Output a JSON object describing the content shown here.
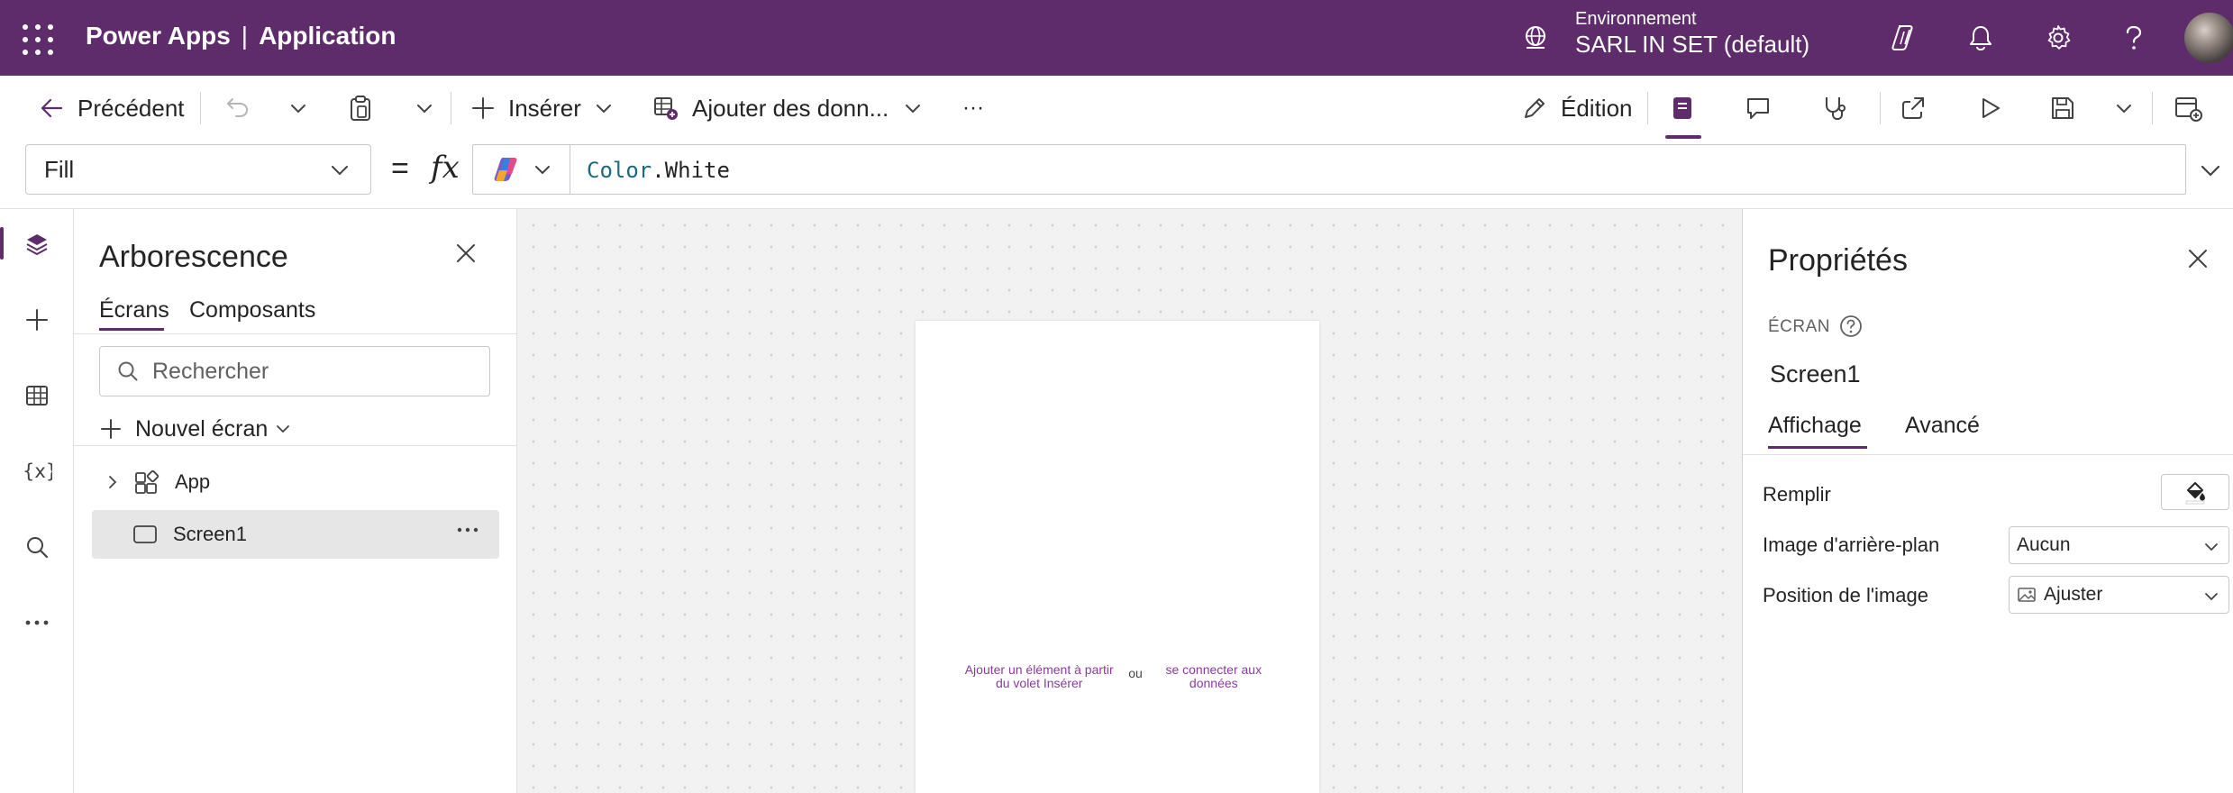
{
  "topbar": {
    "product": "Power Apps",
    "separator": "|",
    "app_name": "Application",
    "environment_label": "Environnement",
    "environment_value": "SARL IN SET (default)"
  },
  "commandbar": {
    "back": "Précédent",
    "insert": "Insérer",
    "add_data": "Ajouter des donn...",
    "more": "···",
    "edit": "Édition"
  },
  "formula": {
    "property": "Fill",
    "equals": "=",
    "fx": "fx",
    "expr_object": "Color",
    "expr_member": ".White"
  },
  "tree": {
    "title": "Arborescence",
    "tabs": [
      "Écrans",
      "Composants"
    ],
    "search_placeholder": "Rechercher",
    "new_screen": "Nouvel écran",
    "items": [
      {
        "label": "App"
      },
      {
        "label": "Screen1"
      }
    ],
    "row_more": "···"
  },
  "canvas": {
    "hint_insert": "Ajouter un élément à partir du volet Insérer",
    "hint_or": "ou",
    "hint_data": "se connecter aux données"
  },
  "properties": {
    "title": "Propriétés",
    "kind": "ÉCRAN",
    "control_name": "Screen1",
    "tabs": [
      "Affichage",
      "Avancé"
    ],
    "rows": {
      "fill_label": "Remplir",
      "bg_image_label": "Image d'arrière-plan",
      "bg_image_value": "Aucun",
      "image_position_label": "Position de l'image",
      "image_position_value": "Ajuster"
    }
  },
  "colors": {
    "brand": "#5e2c6b",
    "link": "#8a3aa0",
    "formula_keyword": "#1d6b76"
  },
  "icons": [
    "waffle-icon",
    "globe-icon",
    "copilot-icon",
    "bell-icon",
    "gear-icon",
    "help-icon",
    "back-arrow-icon",
    "undo-icon",
    "paste-icon",
    "plus-icon",
    "add-data-icon",
    "pencil-icon",
    "tree-view-icon",
    "comment-icon",
    "app-checker-icon",
    "share-icon",
    "play-icon",
    "save-icon",
    "publish-icon",
    "layers-icon",
    "table-icon",
    "variables-icon",
    "search-icon",
    "more-icon",
    "close-icon",
    "chevron-down-icon",
    "chevron-right-icon",
    "app-icon",
    "screen-icon",
    "paint-bucket-icon",
    "image-icon"
  ]
}
